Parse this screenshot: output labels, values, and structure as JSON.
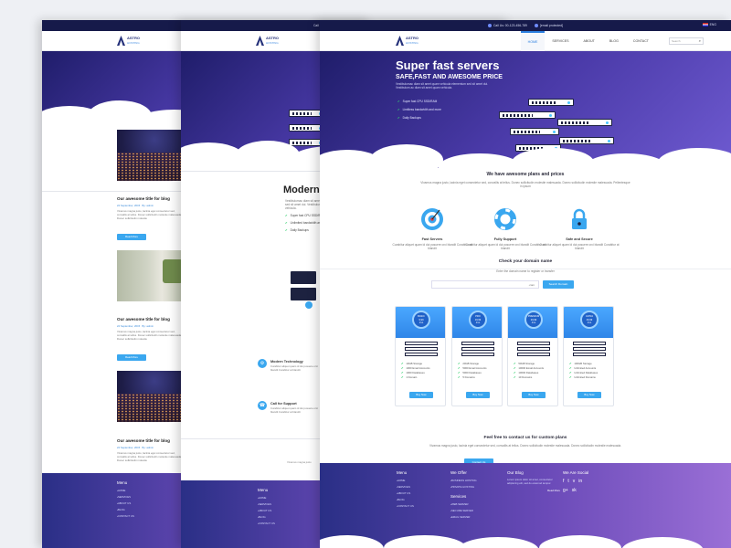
{
  "topbar": {
    "phone": "Call Us: 00-123-456-789",
    "email": "[email protected]",
    "language": "ENG"
  },
  "brand": {
    "name": "ASTRO",
    "tagline": "HOSTING"
  },
  "nav": [
    {
      "label": "HOME",
      "active": true
    },
    {
      "label": "SERVICES",
      "active": false
    },
    {
      "label": "ABOUT",
      "active": false
    },
    {
      "label": "BLOG",
      "active": false
    },
    {
      "label": "CONTACT",
      "active": false
    }
  ],
  "search": {
    "placeholder": "Search"
  },
  "hero": {
    "title": "Super fast servers",
    "subtitle": "SAFE,FAST AND AWESOME PRICE",
    "description": "Vestibulumac diam sit amet quam vehicula elementum sed sit amet dui. Vestibulum ac diam sit amet quam vehicula.",
    "features": [
      "Super fast CPU SSD/RAM",
      "Limitless bandwidth and more",
      "Daily Backups"
    ]
  },
  "plans_intro": {
    "title": "We have awesome plans and prices",
    "text": "Vivamus magna justo, lacinia eget consectetur sed, convallis at tellus. Donec sollicitudin molestie malesuada. Donec sollicitudin molestie malesuada. Pellentesque in ipsum"
  },
  "features": [
    {
      "icon": "target-icon",
      "title": "Fast Servers",
      "text": "Curabitur aliquet quam id dui posuere orci blandit Curabitur at blandit",
      "color": "#3aa7ef"
    },
    {
      "icon": "lifebuoy-icon",
      "title": "Fully Support",
      "text": "Curabitur aliquet quam id dui posuere orci blandit Curabitur at blandit",
      "color": "#3aa7ef"
    },
    {
      "icon": "lock-icon",
      "title": "Safe and Secure",
      "text": "Curabitur aliquet quam id dui posuere orci blandit Curabitur at blandit",
      "color": "#3aa7ef"
    }
  ],
  "domain": {
    "title": "Check your domain name",
    "text": "Enter the domain name to register or transfer",
    "select": ".com",
    "button": "Search Domain"
  },
  "pricing": [
    {
      "name": "BASIC",
      "price": "9,99",
      "period": "/mo",
      "features": [
        "10GB Storage",
        "1000 Email Accounts",
        "1000 Databases",
        "1 Domain"
      ],
      "button": "Buy Now"
    },
    {
      "name": "PRO",
      "price": "19,99",
      "period": "/mo",
      "features": [
        "20GB Storage",
        "5000 Email Accounts",
        "5000 Databases",
        "5 Domains"
      ],
      "button": "Buy Now"
    },
    {
      "name": "PREMIUM",
      "price": "29,99",
      "period": "/mo",
      "features": [
        "50GB Storage",
        "10000 Email Accounts",
        "10000 Databases",
        "10 Domains"
      ],
      "button": "Buy Now"
    },
    {
      "name": "ULTRA",
      "price": "49,99",
      "period": "/mo",
      "features": [
        "100GB Storage",
        "Unlimited Accounts",
        "Unlimited Databases",
        "Unlimited Domains"
      ],
      "button": "Buy Now"
    }
  ],
  "contact": {
    "title": "Feel free to contact us for custom plans",
    "text": "Vivamus magna justo, lacinia eget consectetur sed, convallis at tellus. Donec sollicitudin molestie malesuada. Donec sollicitudin molestie malesuada.",
    "button": "Contact Us"
  },
  "footer": {
    "menu_title": "Menu",
    "menu": [
      "HOME",
      "SERVICES",
      "ABOUT US",
      "BLOG",
      "CONTACT US"
    ],
    "offer_title": "We Offer",
    "offer": [
      "BUSINESS HOSTING",
      "PRIVATE HOSTING"
    ],
    "service_title": "Services",
    "services": [
      "WEB SERVER",
      "SECURE SERVER",
      "EMAIL SERVER"
    ],
    "blog_title": "Our Blog",
    "blog_post": "Lorem ipsum dolor sit amet, consectetur adipiscing elit, sed do eiusmod tempor.",
    "blog_more": "Read More",
    "social_title": "We Are Social",
    "social": [
      "f",
      "t",
      "v",
      "in",
      "g+",
      "sk"
    ]
  },
  "blog": {
    "title": "Our awesome title for blog",
    "date": "24 September, 2015",
    "author": "By: admin",
    "text": "Vivamus magna justo, lacinia eget consectetur sed, convallis at tellus. Donec sollicitudin molestie malesuada. Donec sollicitudin molestie",
    "button": "Read More"
  },
  "about": {
    "title": "Modern and",
    "text": "Vestibulumac diam sit amet quam vehicula elementum sed sit amet dui. Vestibulum ac diam sit amet quam vehicula.",
    "features": [
      "Super fast CPU SSD/RAM",
      "Unlimited bandwidth and",
      "Daily Backups"
    ],
    "items": [
      {
        "icon": "gear-icon",
        "title": "Modern Technology",
        "text": "Curabitur aliquet quam id dui posuere orci blandit Curabitur at blandit"
      },
      {
        "icon": "phone-icon",
        "title": "Call for Support",
        "text": "Curabitur aliquet quam id dui posuere orci blandit Curabitur at blandit"
      }
    ],
    "footnote": "Vivamus magna justo"
  },
  "colors": {
    "accent": "#3aa7ef",
    "dark": "#161a4a",
    "brand": "#26327a"
  }
}
